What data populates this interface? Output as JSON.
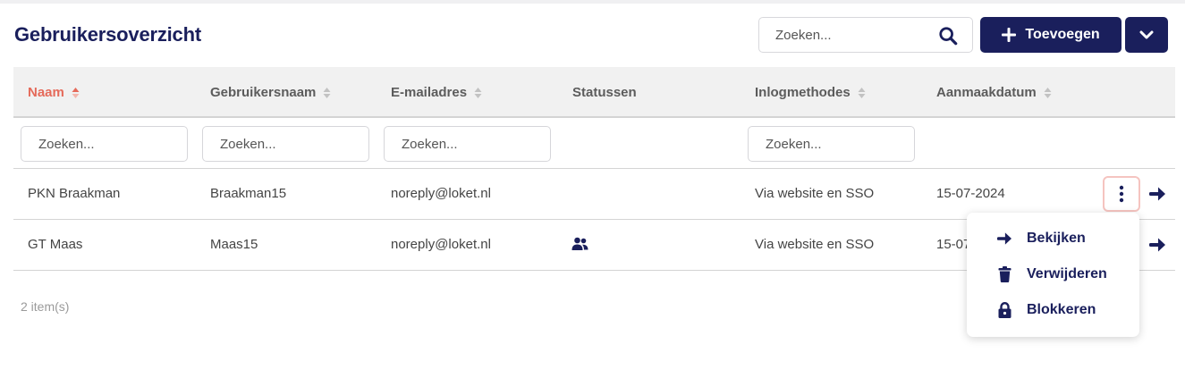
{
  "header": {
    "title": "Gebruikersoverzicht",
    "search_placeholder": "Zoeken...",
    "add_label": "Toevoegen"
  },
  "table": {
    "columns": [
      {
        "label": "Naam",
        "sortable": true,
        "active": true
      },
      {
        "label": "Gebruikersnaam",
        "sortable": true
      },
      {
        "label": "E-mailadres",
        "sortable": true
      },
      {
        "label": "Statussen",
        "sortable": false
      },
      {
        "label": "Inlogmethodes",
        "sortable": true
      },
      {
        "label": "Aanmaakdatum",
        "sortable": true
      }
    ],
    "filter_placeholder": "Zoeken...",
    "rows": [
      {
        "naam": "PKN Braakman",
        "gebruikersnaam": "Braakman15",
        "email": "noreply@loket.nl",
        "status_icon": "",
        "inlog": "Via website en SSO",
        "datum": "15-07-2024"
      },
      {
        "naam": "GT Maas",
        "gebruikersnaam": "Maas15",
        "email": "noreply@loket.nl",
        "status_icon": "users-icon",
        "inlog": "Via website en SSO",
        "datum": "15-07"
      }
    ]
  },
  "footer": {
    "count": "2 item(s)"
  },
  "context_menu": {
    "items": [
      {
        "label": "Bekijken",
        "icon": "arrow-right-icon"
      },
      {
        "label": "Verwijderen",
        "icon": "trash-icon"
      },
      {
        "label": "Blokkeren",
        "icon": "lock-icon"
      }
    ]
  },
  "colors": {
    "primary": "#1a1f5c",
    "sort_active": "#e56a5a"
  }
}
